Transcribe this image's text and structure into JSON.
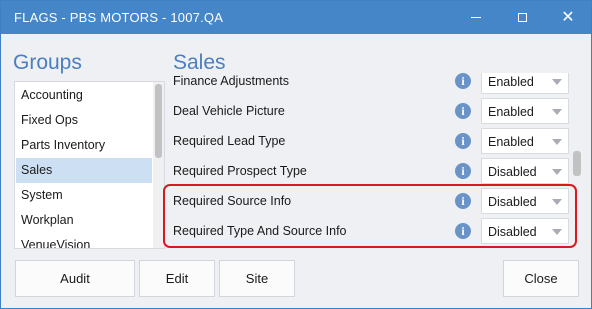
{
  "window": {
    "title": "FLAGS - PBS MOTORS - 1007.QA",
    "minimize_glyph": "minimize-icon",
    "maximize_glyph": "maximize-icon",
    "close_glyph": "✕"
  },
  "groups": {
    "header": "Groups",
    "items": [
      {
        "label": "Accounting"
      },
      {
        "label": "Fixed Ops"
      },
      {
        "label": "Parts Inventory"
      },
      {
        "label": "Sales",
        "selected": true
      },
      {
        "label": "System"
      },
      {
        "label": "Workplan"
      },
      {
        "label": "VenueVision"
      }
    ]
  },
  "sales": {
    "header": "Sales",
    "rows": [
      {
        "label": "Finance Adjustments",
        "value": "Enabled"
      },
      {
        "label": "Deal Vehicle Picture",
        "value": "Enabled"
      },
      {
        "label": "Required Lead Type",
        "value": "Enabled"
      },
      {
        "label": "Required Prospect Type",
        "value": "Disabled"
      },
      {
        "label": "Required Source Info",
        "value": "Disabled"
      },
      {
        "label": "Required Type And Source Info",
        "value": "Disabled"
      }
    ],
    "info_glyph": "i"
  },
  "buttons": {
    "audit": "Audit",
    "edit": "Edit",
    "site": "Site",
    "close": "Close"
  },
  "colors": {
    "titlebar": "#4586c9",
    "header_text": "#4a7fc0",
    "selected_group": "#cde0f3",
    "highlight": "#d8191f",
    "info_icon": "#6a93c8"
  }
}
